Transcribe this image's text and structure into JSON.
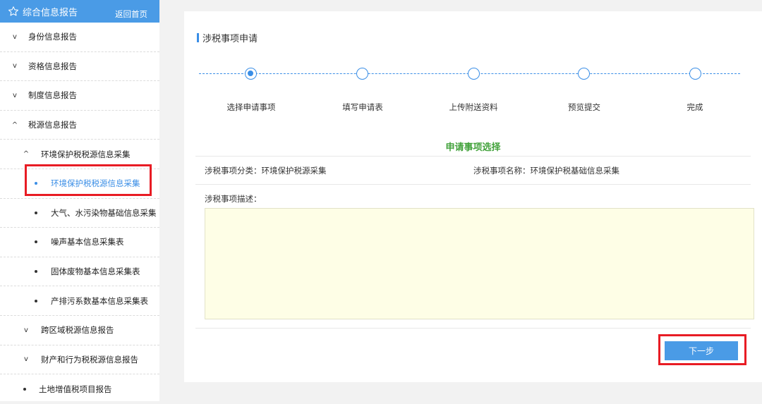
{
  "sidebar": {
    "header": {
      "title": "综合信息报告",
      "home_link": "返回首页",
      "icon": "star-icon"
    },
    "items": [
      {
        "label": "身份信息报告",
        "level": 1,
        "marker": "v"
      },
      {
        "label": "资格信息报告",
        "level": 1,
        "marker": "v"
      },
      {
        "label": "制度信息报告",
        "level": 1,
        "marker": "v"
      },
      {
        "label": "税源信息报告",
        "level": 1,
        "marker": "^"
      },
      {
        "label": "环境保护税税源信息采集",
        "level": 2,
        "marker": "^"
      },
      {
        "label": "环境保护税税源信息采集",
        "level": 3,
        "marker": "•",
        "active": true
      },
      {
        "label": "大气、水污染物基础信息采集",
        "level": 3,
        "marker": "•"
      },
      {
        "label": "噪声基本信息采集表",
        "level": 3,
        "marker": "•"
      },
      {
        "label": "固体废物基本信息采集表",
        "level": 3,
        "marker": "•"
      },
      {
        "label": "产排污系数基本信息采集表",
        "level": 3,
        "marker": "•"
      },
      {
        "label": "跨区域税源信息报告",
        "level": 2,
        "marker": "v"
      },
      {
        "label": "财产和行为税税源信息报告",
        "level": 2,
        "marker": "v"
      },
      {
        "label": "土地增值税项目报告",
        "level": 1,
        "marker": "•"
      }
    ]
  },
  "main": {
    "section_title": "涉税事项申请",
    "steps": [
      "选择申请事项",
      "填写申请表",
      "上传附送资料",
      "预览提交",
      "完成"
    ],
    "current_step": 1,
    "form_title": "申请事项选择",
    "category_label": "涉税事项分类：",
    "category_value": "环境保护税源采集",
    "name_label": "涉税事项名称：",
    "name_value": "环境保护税基础信息采集",
    "desc_label": "涉税事项描述：",
    "desc_value": "",
    "next_button": "下一步"
  },
  "colors": {
    "accent": "#4a9be6",
    "highlight": "#e81c24",
    "form_title": "#42a23b",
    "desc_bg": "#fefee6"
  }
}
